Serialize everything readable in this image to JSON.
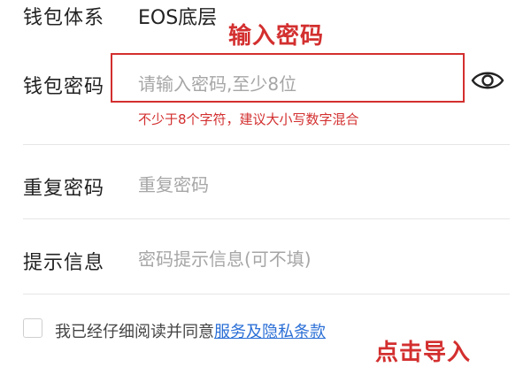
{
  "form": {
    "wallet_system": {
      "label": "钱包体系",
      "value": "EOS底层"
    },
    "password": {
      "label": "钱包密码",
      "placeholder": "请输入密码,至少8位",
      "hint": "不少于8个字符，建议大小写数字混合"
    },
    "repeat_password": {
      "label": "重复密码",
      "placeholder": "重复密码"
    },
    "hint_info": {
      "label": "提示信息",
      "placeholder": "密码提示信息(可不填)"
    }
  },
  "agreement": {
    "text": "我已经仔细阅读并同意",
    "link": "服务及隐私条款"
  },
  "annotations": {
    "enter_password": "输入密码",
    "click_import": "点击导入"
  },
  "icons": {
    "toggle_visibility": "eye-icon"
  },
  "colors": {
    "annotation_red": "#d32f2f",
    "link_blue": "#2b6fd6",
    "placeholder_gray": "#a6a6a6"
  }
}
